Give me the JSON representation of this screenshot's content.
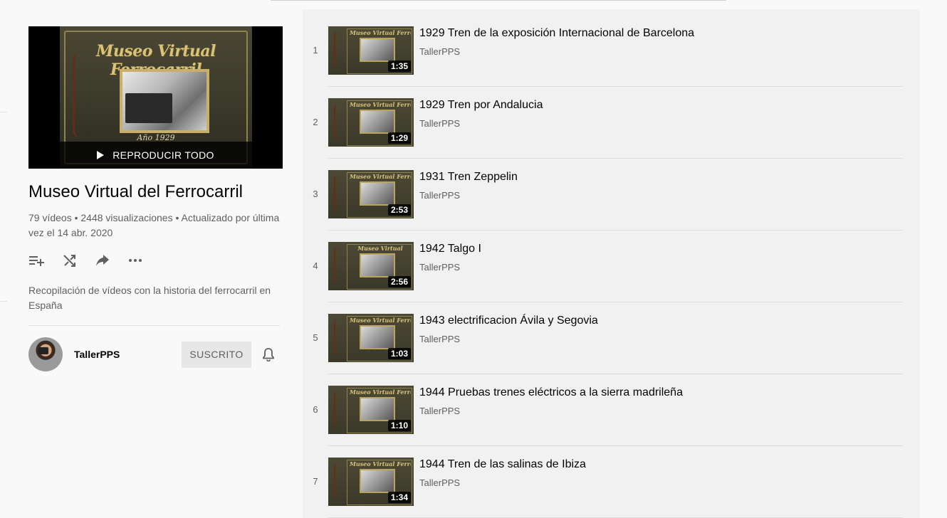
{
  "playlist": {
    "hero_title": "Museo Virtual Ferrocarril",
    "hero_caption": "Año 1929",
    "play_all_label": "REPRODUCIR TODO",
    "title": "Museo Virtual del Ferrocarril",
    "stats": "79 vídeos • 2448 visualizaciones • Actualizado por última vez el 14 abr. 2020",
    "description": "Recopilación de vídeos con la historia del ferrocarril en España",
    "actions": [
      {
        "icon": "add-to-queue-icon"
      },
      {
        "icon": "shuffle-icon"
      },
      {
        "icon": "share-icon"
      },
      {
        "icon": "more-icon"
      }
    ]
  },
  "owner": {
    "name": "TallerPPS",
    "subscribe_label": "SUSCRITO",
    "bell_icon": "bell-icon"
  },
  "videos": [
    {
      "index": "1",
      "title": "1929 Tren de la exposición Internacional de Barcelona",
      "channel": "TallerPPS",
      "duration": "1:35",
      "thumb_title": "Museo Virtual Ferrocarril"
    },
    {
      "index": "2",
      "title": "1929 Tren por Andalucia",
      "channel": "TallerPPS",
      "duration": "1:29",
      "thumb_title": "Museo Virtual Ferrocarril"
    },
    {
      "index": "3",
      "title": "1931 Tren Zeppelin",
      "channel": "TallerPPS",
      "duration": "2:53",
      "thumb_title": "Museo Virtual Ferrocarril"
    },
    {
      "index": "4",
      "title": "1942 Talgo I",
      "channel": "TallerPPS",
      "duration": "2:56",
      "thumb_title": "Museo Virtual"
    },
    {
      "index": "5",
      "title": "1943 electrificacion Ávila y Segovia",
      "channel": "TallerPPS",
      "duration": "1:03",
      "thumb_title": "Museo Virtual Ferrocarril"
    },
    {
      "index": "6",
      "title": "1944 Pruebas trenes eléctricos a la sierra madrileña",
      "channel": "TallerPPS",
      "duration": "1:10",
      "thumb_title": "Museo Virtual Ferrocarril"
    },
    {
      "index": "7",
      "title": "1944 Tren de las salinas de Ibiza",
      "channel": "TallerPPS",
      "duration": "1:34",
      "thumb_title": "Museo Virtual Ferrocarril"
    }
  ]
}
